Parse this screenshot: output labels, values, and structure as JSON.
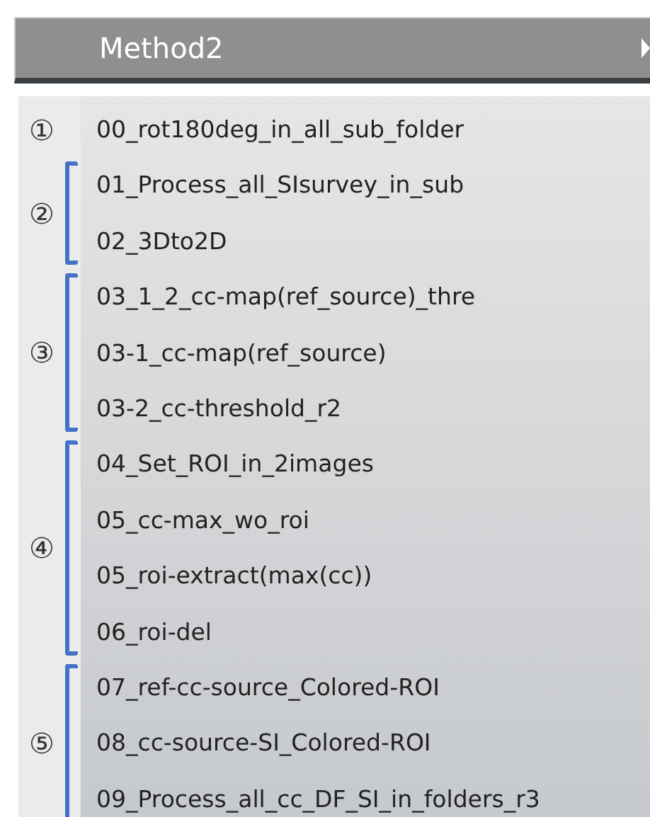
{
  "header": {
    "title": "Method2"
  },
  "groups": [
    {
      "marker": "①",
      "bracket": false,
      "items": [
        "00_rot180deg_in_all_sub_folder"
      ]
    },
    {
      "marker": "②",
      "bracket": true,
      "items": [
        "01_Process_all_SIsurvey_in_sub",
        "02_3Dto2D"
      ]
    },
    {
      "marker": "③",
      "bracket": true,
      "items": [
        "03_1_2_cc-map(ref_source)_thre",
        "03-1_cc-map(ref_source)",
        "03-2_cc-threshold_r2"
      ]
    },
    {
      "marker": "④",
      "bracket": true,
      "items": [
        "04_Set_ROI_in_2images",
        "05_cc-max_wo_roi",
        "05_roi-extract(max(cc))",
        "06_roi-del"
      ]
    },
    {
      "marker": "⑤",
      "bracket": true,
      "items": [
        "07_ref-cc-source_Colored-ROI",
        "08_cc-source-SI_Colored-ROI",
        "09_Process_all_cc_DF_SI_in_folders_r3"
      ]
    }
  ]
}
